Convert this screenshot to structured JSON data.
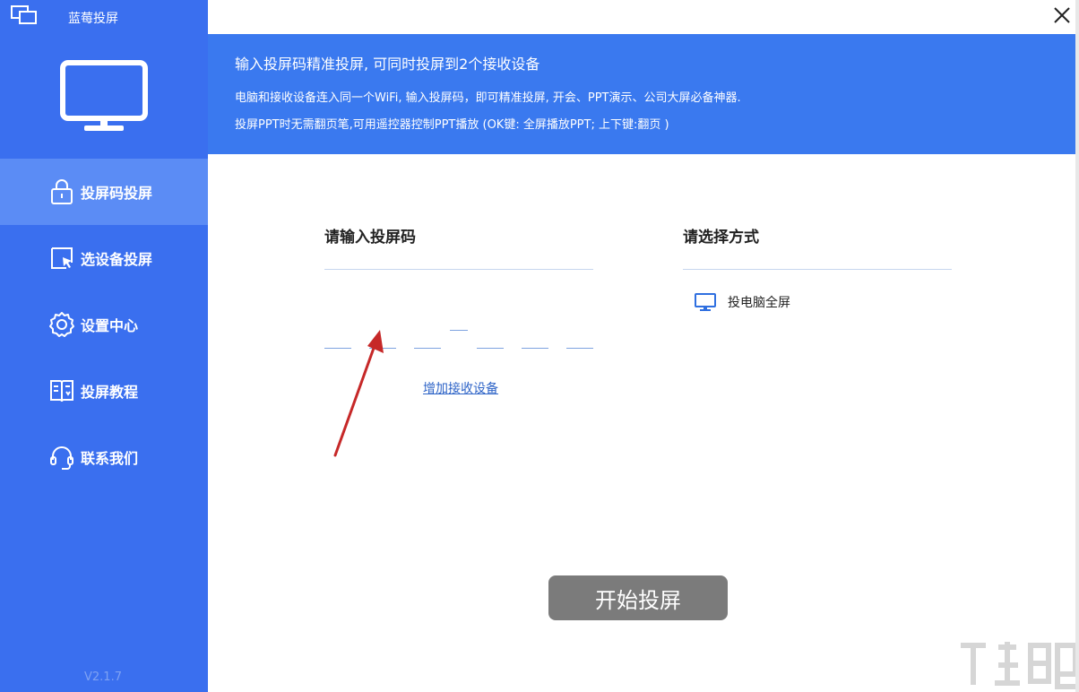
{
  "app": {
    "title": "蓝莓投屏",
    "version": "V2.1.7"
  },
  "sidebar": {
    "items": [
      {
        "label": "投屏码投屏",
        "icon": "lock-icon",
        "active": true
      },
      {
        "label": "选设备投屏",
        "icon": "cursor-select-icon",
        "active": false
      },
      {
        "label": "设置中心",
        "icon": "gear-icon",
        "active": false
      },
      {
        "label": "投屏教程",
        "icon": "book-icon",
        "active": false
      },
      {
        "label": "联系我们",
        "icon": "headset-icon",
        "active": false
      }
    ]
  },
  "banner": {
    "title": "输入投屏码精准投屏, 可同时投屏到2个接收设备",
    "line1": "电脑和接收设备连入同一个WiFi, 输入投屏码，即可精准投屏, 开会、PPT演示、公司大屏必备神器.",
    "line2": "投屏PPT时无需翻页笔,可用遥控器控制PPT播放 (OK键: 全屏播放PPT; 上下键:翻页 )"
  },
  "code_section": {
    "title": "请输入投屏码",
    "add_device_label": "增加接收设备"
  },
  "mode_section": {
    "title": "请选择方式",
    "option_label": "投电脑全屏"
  },
  "start_button": {
    "label": "开始投屏"
  },
  "colors": {
    "sidebar_bg": "#3a6fef",
    "sidebar_active": "#5b8cf5",
    "banner_bg": "#3a79ef",
    "start_button_bg": "#7b7b7b",
    "link": "#2d63c7",
    "annotation_arrow": "#c62828"
  }
}
